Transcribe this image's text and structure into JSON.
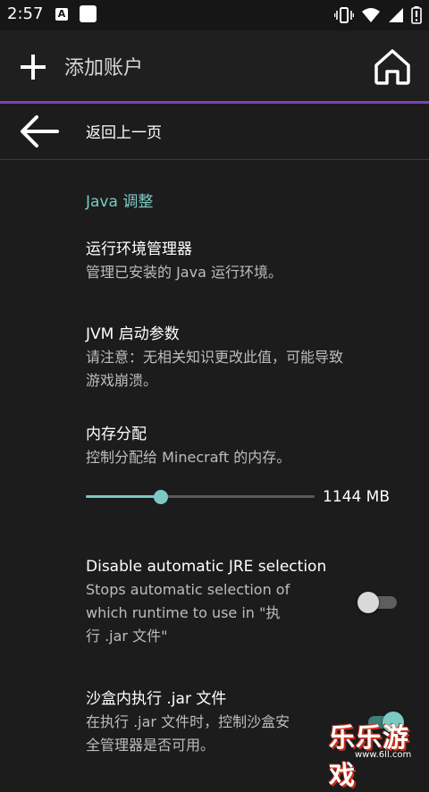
{
  "status_bar": {
    "time": "2:57",
    "notification_letter": "A",
    "icons": [
      "vibrate-icon",
      "wifi-icon",
      "signal-icon",
      "battery-icon"
    ]
  },
  "app_bar": {
    "title": "添加账户",
    "accent_color": "#7e3fbe"
  },
  "back": {
    "label": "返回上一页"
  },
  "section": {
    "header": "Java 调整",
    "accent_color": "#7cc9c3"
  },
  "prefs": {
    "runtime_manager": {
      "title": "运行环境管理器",
      "summary": "管理已安装的 Java 运行环境。"
    },
    "jvm_args": {
      "title": "JVM 启动参数",
      "summary_line1": "请注意：无相关知识更改此值，可能导致",
      "summary_line2": "游戏崩溃。"
    },
    "memory": {
      "title": "内存分配",
      "summary": "控制分配给 Minecraft 的内存。",
      "value_label": "1144 MB",
      "slider_fraction": 0.33
    },
    "disable_jre": {
      "title": "Disable automatic JRE selection",
      "summary_line1": "Stops automatic selection of",
      "summary_line2": "which runtime to use in \"执",
      "summary_line3": "行 .jar 文件\"",
      "enabled": false
    },
    "sandbox": {
      "title": "沙盒内执行 .jar 文件",
      "summary_line1": "在执行 .jar 文件时，控制沙盒安",
      "summary_line2": "全管理器是否可用。",
      "enabled": true
    }
  },
  "watermark": {
    "text": "乐乐游戏",
    "url": "www.6ll.com"
  }
}
